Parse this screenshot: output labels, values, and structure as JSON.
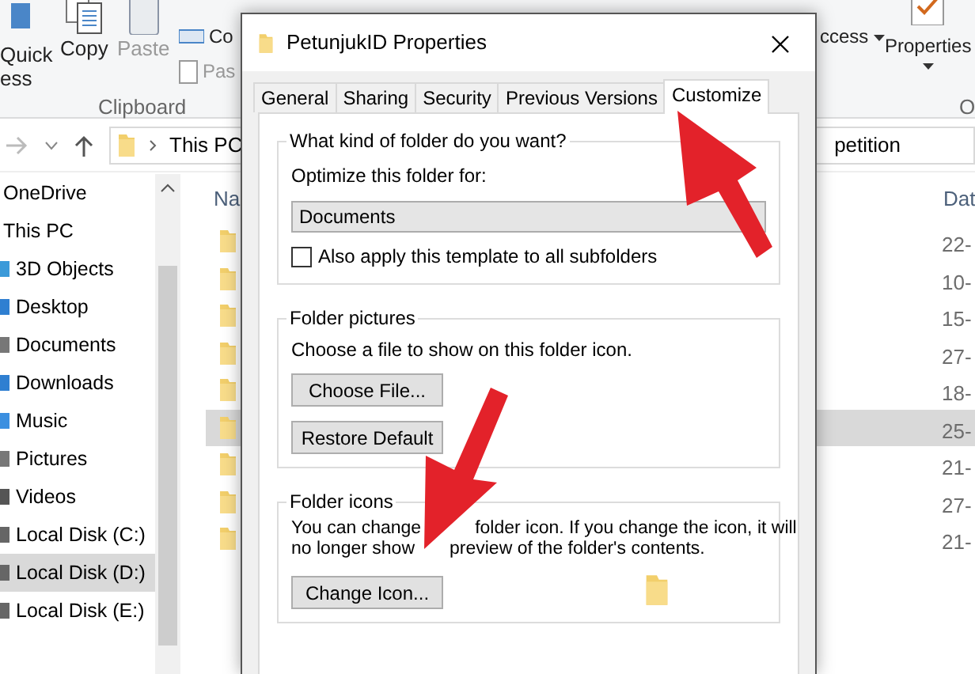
{
  "ribbon": {
    "large_buttons": [
      {
        "lines": [
          "Quick",
          "ess"
        ],
        "disabled": false
      },
      {
        "lines": [
          "Copy"
        ],
        "disabled": false
      },
      {
        "lines": [
          "Paste"
        ],
        "disabled": true
      }
    ],
    "small_buttons": [
      {
        "label": "Co",
        "disabled": false
      },
      {
        "label": "Pas",
        "disabled": true
      }
    ],
    "group_label": "Clipboard",
    "right_menu": "ccess",
    "properties": "Properties",
    "right_group_label": "O"
  },
  "address_bar": {
    "path": "This PC",
    "tail": "petition"
  },
  "navigation": [
    {
      "label": "OneDrive",
      "selected": false
    },
    {
      "label": "This PC",
      "selected": false
    },
    {
      "label": "3D Objects",
      "selected": false
    },
    {
      "label": "Desktop",
      "selected": false
    },
    {
      "label": "Documents",
      "selected": false
    },
    {
      "label": "Downloads",
      "selected": false
    },
    {
      "label": "Music",
      "selected": false
    },
    {
      "label": "Pictures",
      "selected": false
    },
    {
      "label": "Videos",
      "selected": false
    },
    {
      "label": "Local Disk (C:)",
      "selected": false
    },
    {
      "label": "Local Disk (D:)",
      "selected": true
    },
    {
      "label": "Local Disk (E:)",
      "selected": false
    }
  ],
  "file_list": {
    "columns": [
      "Na",
      "Dat"
    ],
    "rows": [
      {
        "date": "22-",
        "selected": false
      },
      {
        "date": "10-",
        "selected": false
      },
      {
        "date": "15-",
        "selected": false
      },
      {
        "date": "27-",
        "selected": false
      },
      {
        "date": "18-",
        "selected": false
      },
      {
        "date": "25-",
        "selected": true
      },
      {
        "date": "21-",
        "selected": false
      },
      {
        "date": "27-",
        "selected": false
      },
      {
        "date": "21-",
        "selected": false
      }
    ]
  },
  "dialog": {
    "title": "PetunjukID Properties",
    "tabs": [
      {
        "label": "General",
        "selected": false
      },
      {
        "label": "Sharing",
        "selected": false
      },
      {
        "label": "Security",
        "selected": false
      },
      {
        "label": "Previous Versions",
        "selected": false
      },
      {
        "label": "Customize",
        "selected": true
      }
    ],
    "folder_type": {
      "heading": "What kind of folder do you want?",
      "label": "Optimize this folder for:",
      "value": "Documents",
      "checkbox": {
        "label": "Also apply this template to all subfolders",
        "checked": false
      }
    },
    "folder_pictures": {
      "heading": "Folder pictures",
      "text": "Choose a file to show on this folder icon.",
      "buttons": [
        "Choose File...",
        "Restore Default"
      ]
    },
    "folder_icons": {
      "heading": "Folder icons",
      "lines": [
        [
          "You can change",
          "folder icon. If you change the icon, it will"
        ],
        [
          "no longer show",
          "preview of the folder's contents."
        ]
      ],
      "button": "Change Icon..."
    }
  }
}
